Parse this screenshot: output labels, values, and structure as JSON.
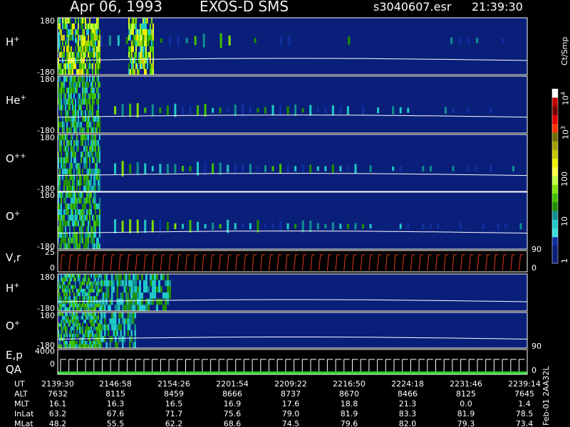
{
  "header": {
    "date": "Apr 06, 1993",
    "title": "EXOS-D SMS",
    "file": "s3040607.esr",
    "time": "21:39:30"
  },
  "colors": {
    "background": "#000000",
    "plot_background": "#0a1f7a",
    "trace": "#ffffff",
    "vr_trace": "#e8381f",
    "qa_bar": "#2fd62f"
  },
  "chart_data": [
    {
      "type": "heatmap",
      "panel": "H+",
      "label": "H",
      "label_sup": "+",
      "ylim": [
        -180,
        180
      ],
      "ytick_labels": [
        "180",
        "-180"
      ],
      "intensity_scale": "log",
      "active_bands_ut_fraction": [
        [
          0.0,
          1.0
        ]
      ]
    },
    {
      "type": "heatmap",
      "panel": "He+",
      "label": "He",
      "label_sup": "+",
      "ylim": [
        -180,
        180
      ],
      "ytick_labels": [
        "180",
        "-180"
      ],
      "intensity_scale": "log"
    },
    {
      "type": "heatmap",
      "panel": "O++",
      "label": "O",
      "label_sup": "++",
      "ylim": [
        -180,
        180
      ],
      "ytick_labels": [
        "180",
        "-180"
      ],
      "intensity_scale": "log"
    },
    {
      "type": "heatmap",
      "panel": "O+",
      "label": "O",
      "label_sup": "+",
      "ylim": [
        -180,
        180
      ],
      "ytick_labels": [
        "180",
        "-180"
      ],
      "intensity_scale": "log"
    },
    {
      "type": "line",
      "panel": "V,r",
      "label": "V,r",
      "ytick_labels": [
        "25",
        "0"
      ],
      "right_tick_labels": [
        "90",
        "0"
      ],
      "ylim": [
        0,
        25
      ]
    },
    {
      "type": "heatmap",
      "panel": "H+ (2)",
      "label": "H",
      "label_sup": "+",
      "ylim": [
        -180,
        180
      ],
      "ytick_labels": [
        "180",
        "-180"
      ]
    },
    {
      "type": "heatmap",
      "panel": "O+ (2)",
      "label": "O",
      "label_sup": "+",
      "ylim": [
        -180,
        180
      ],
      "ytick_labels": [
        "180",
        "-180"
      ],
      "right_tick_labels": [
        "90"
      ]
    },
    {
      "type": "line",
      "panel": "E,p QA",
      "label": "E,p",
      "label2": "QA",
      "ytick_labels": [
        "4000",
        "0"
      ],
      "right_tick_labels": [
        "0"
      ],
      "ylim": [
        0,
        4000
      ]
    }
  ],
  "colorbar": {
    "unit_label": "Ct/Smp",
    "tick_labels": [
      "10",
      "4",
      "10",
      "3",
      "100",
      "10",
      "1"
    ],
    "labels": [
      {
        "text": "10",
        "sup": "4"
      },
      {
        "text": "10",
        "sup": "3"
      },
      {
        "text": "100",
        "sup": ""
      },
      {
        "text": "10",
        "sup": ""
      },
      {
        "text": "1",
        "sup": ""
      }
    ],
    "colors": [
      "#ffffff",
      "#c00000",
      "#7a0000",
      "#e00000",
      "#ff3000",
      "#6e6e00",
      "#a0a000",
      "#c8c800",
      "#f0f000",
      "#ffff40",
      "#c0ff40",
      "#80e000",
      "#40c000",
      "#209000",
      "#109090",
      "#20c8c8",
      "#40e0e0",
      "#1030a0",
      "#0a1f7a",
      "#0a1f7a"
    ]
  },
  "table": {
    "rows": [
      {
        "label": "UT",
        "values": [
          "2139:30",
          "2146:58",
          "2154:26",
          "2201:54",
          "2209:22",
          "2216:50",
          "2224:18",
          "2231:46",
          "2239:14"
        ]
      },
      {
        "label": "ALT",
        "values": [
          "7632",
          "8115",
          "8459",
          "8666",
          "8737",
          "8670",
          "8466",
          "8125",
          "7645"
        ]
      },
      {
        "label": "MLT",
        "values": [
          "16.1",
          "16.3",
          "16.5",
          "16.9",
          "17.6",
          "18.8",
          "21.3",
          "0.0",
          "1.4"
        ]
      },
      {
        "label": "InLat",
        "values": [
          "63.2",
          "67.6",
          "71.7",
          "75.6",
          "79.0",
          "81.9",
          "83.3",
          "81.9",
          "78.5"
        ]
      },
      {
        "label": "MLat",
        "values": [
          "48.2",
          "55.5",
          "62.2",
          "68.6",
          "74.5",
          "79.6",
          "82.0",
          "79.3",
          "73.4"
        ]
      }
    ]
  },
  "footer_vertical": "Feb-01 2AA32L"
}
